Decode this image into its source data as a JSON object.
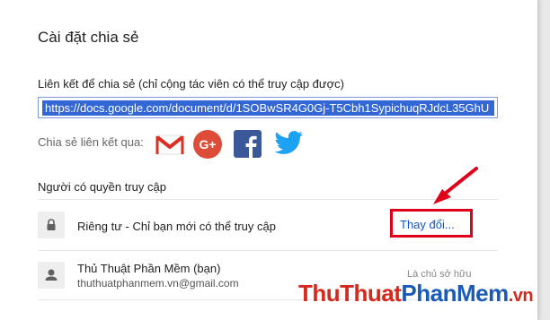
{
  "dialog": {
    "title": "Cài đặt chia sẻ",
    "link_label": "Liên kết để chia sẻ (chỉ cộng tác viên có thể truy cập được)",
    "link_value": "https://docs.google.com/document/d/1SOBwSR4G0Gj-T5Cbh1SypichuqRJdcL35GhU",
    "share_via_label": "Chia sẻ liên kết qua:",
    "social": [
      {
        "icon": "gmail-icon",
        "color": "#d93025"
      },
      {
        "icon": "google-plus-icon",
        "label": "G+",
        "color": "#dd4b39"
      },
      {
        "icon": "facebook-icon",
        "color": "#3b5998"
      },
      {
        "icon": "twitter-icon",
        "color": "#1da1f2"
      }
    ],
    "access_label": "Người có quyền truy cập",
    "privacy": {
      "icon": "lock-icon",
      "text": "Riêng tư - Chỉ bạn mới có thể truy cập",
      "change_link": "Thay đổi..."
    },
    "user": {
      "icon": "person-icon",
      "name": "Thủ Thuật Phần Mềm (bạn)",
      "email": "thuthuatphanmem.vn@gmail.com",
      "role": "Là chủ sở hữu"
    }
  },
  "annotation": {
    "highlight_color": "#e0001a",
    "arrow_color": "#e0001a"
  },
  "watermark": {
    "part1": "ThuThuat",
    "part2": "PhanMem",
    "part3": ".vn"
  }
}
